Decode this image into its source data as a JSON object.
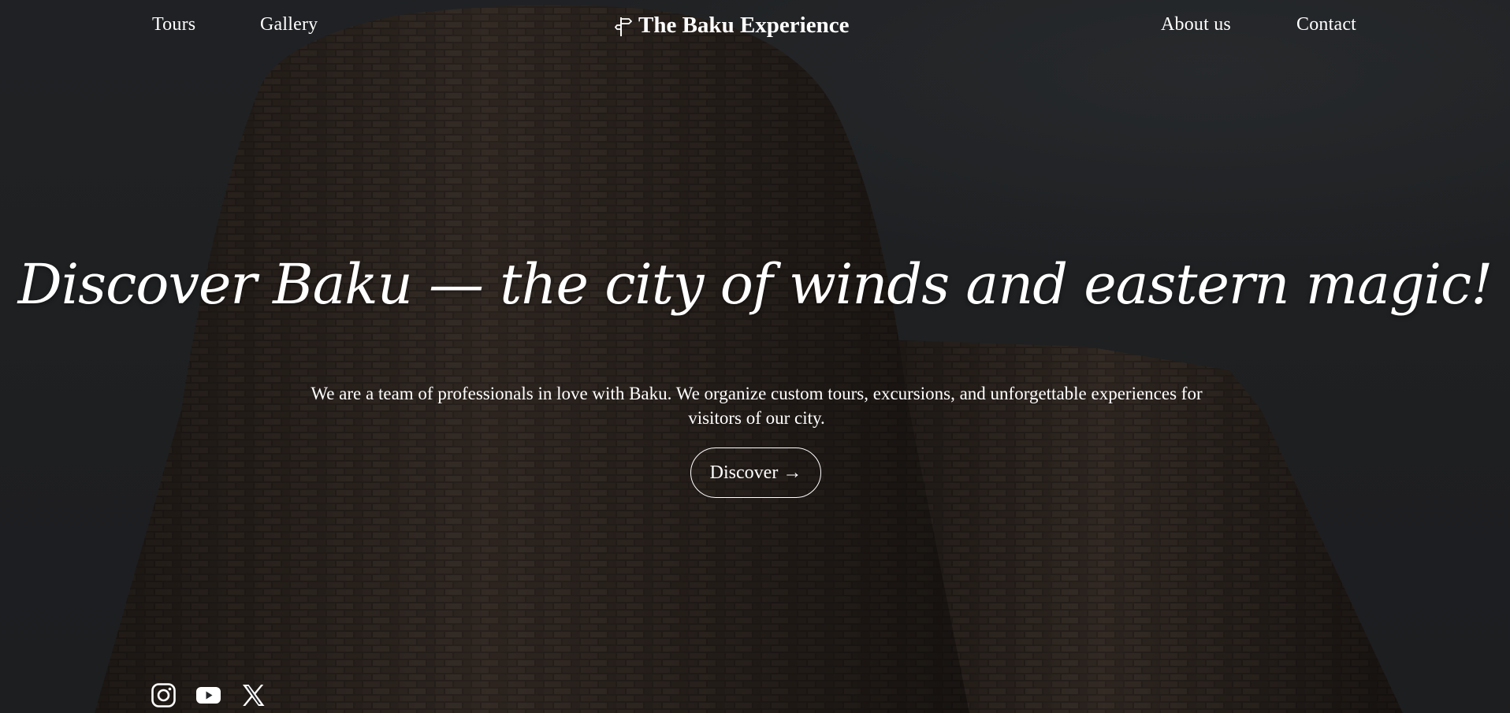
{
  "nav": {
    "left_links": [
      "Tours",
      "Gallery"
    ],
    "right_links": [
      "About us",
      "Contact"
    ],
    "brand": "The Baku Experience",
    "brand_icon": "signpost-icon"
  },
  "hero": {
    "title": "Discover Baku — the city of winds and eastern magic!",
    "description": "We are a team of professionals in love with Baku. We organize custom tours, excursions, and unforgettable experiences for visitors of our city.",
    "button_label": "Discover",
    "button_icon": "arrow-right-icon"
  },
  "social": {
    "icons": [
      "instagram-icon",
      "youtube-icon",
      "x-icon"
    ]
  },
  "colors": {
    "background": "#25272a",
    "text": "#ffffff",
    "stone": "#3a2f29"
  }
}
